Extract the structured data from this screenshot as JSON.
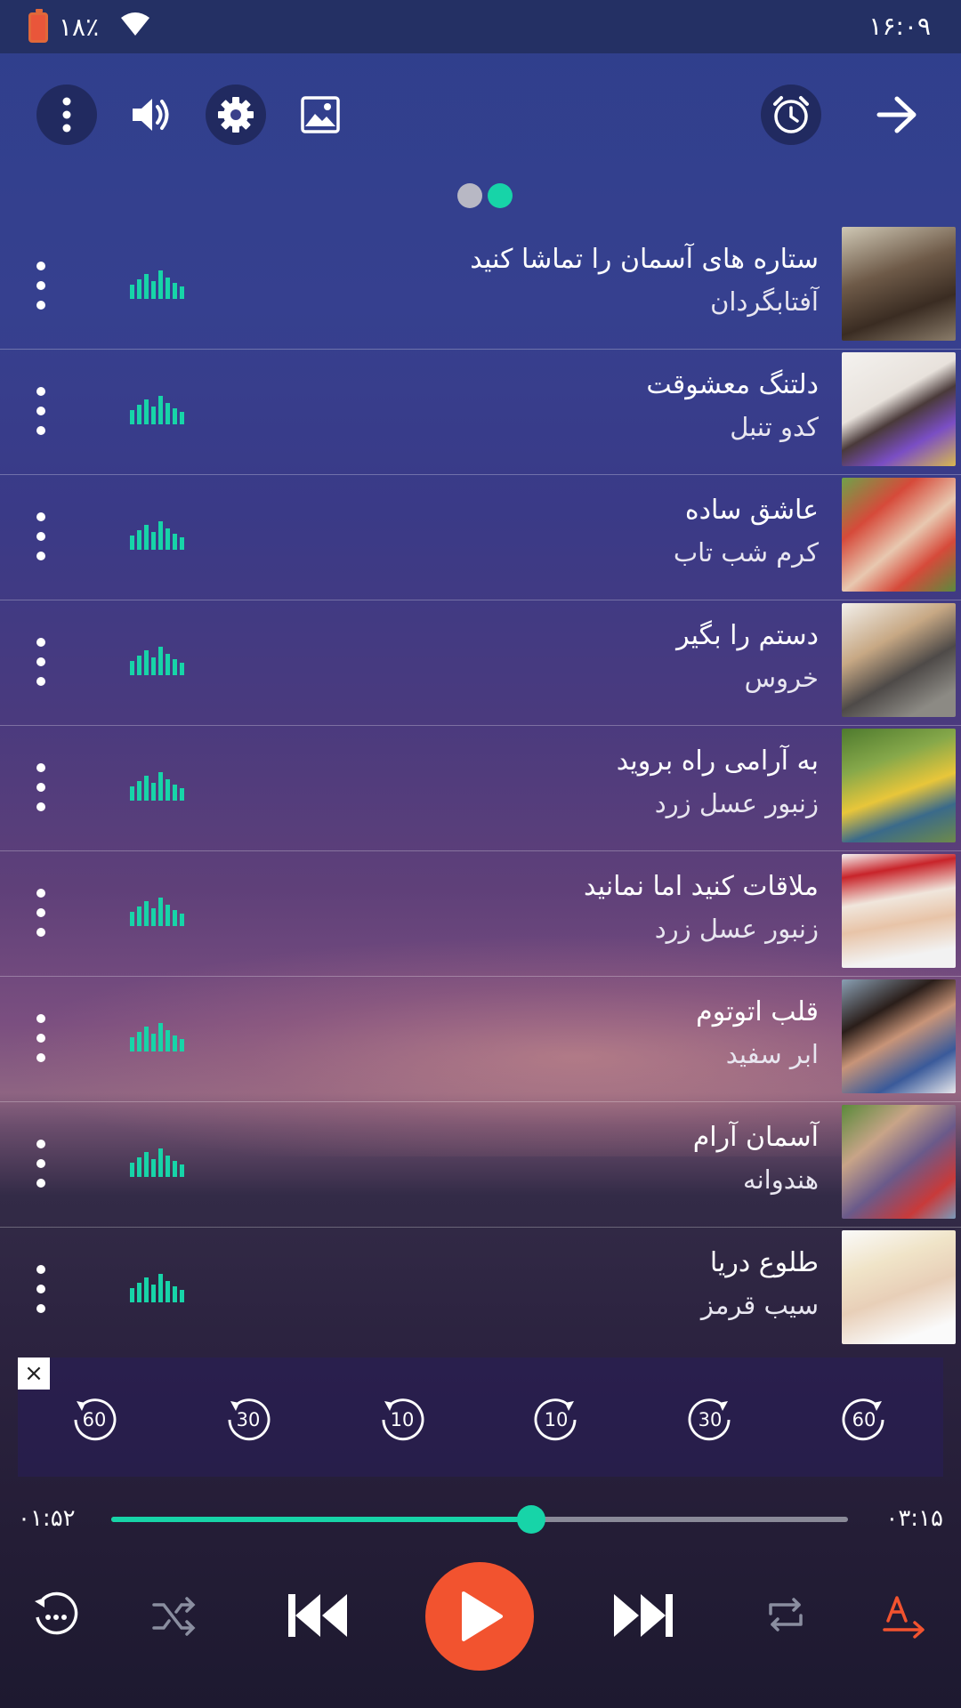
{
  "status": {
    "battery": "۱۸٪",
    "time": "۱۶:۰۹",
    "battery_color": "#e9563a"
  },
  "toolbar": {
    "icons": [
      "more-vert-icon",
      "volume-icon",
      "gear-icon",
      "image-icon",
      "alarm-icon",
      "arrow-right-icon"
    ]
  },
  "pager": {
    "pages": 2,
    "active_page": 2,
    "active_color": "#17d4a8",
    "inactive_color": "#b8b8c4"
  },
  "songs": [
    {
      "title": "ستاره های آسمان را تماشا کنید",
      "artist": "آفتابگردان"
    },
    {
      "title": "دلتنگ معشوقت",
      "artist": "کدو تنبل"
    },
    {
      "title": "عاشق ساده",
      "artist": "کرم شب تاب"
    },
    {
      "title": "دستم را بگیر",
      "artist": "خروس"
    },
    {
      "title": "به آرامی راه بروید",
      "artist": "زنبور عسل زرد"
    },
    {
      "title": "ملاقات کنید اما نمانید",
      "artist": "زنبور عسل زرد"
    },
    {
      "title": "قلب اتوتوم",
      "artist": "ابر سفید"
    },
    {
      "title": "آسمان آرام",
      "artist": "هندوانه"
    },
    {
      "title": "طلوع دریا",
      "artist": "سیب قرمز"
    }
  ],
  "skip_buttons": [
    "60",
    "30",
    "10",
    "10",
    "30",
    "60"
  ],
  "player": {
    "elapsed": "۰۱:۵۲",
    "duration": "۰۳:۱۵",
    "progress": 0.57,
    "accent": "#17d4a8",
    "play_color": "#f2532f"
  }
}
